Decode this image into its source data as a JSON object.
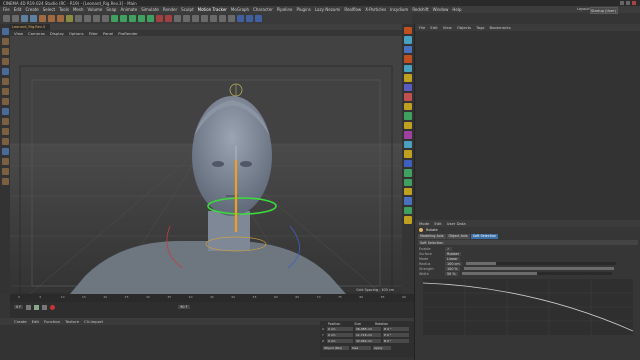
{
  "titlebar": {
    "title": "CINEMA 4D R19.024 Studio (RC - R19) - [Leonard_Rig.Rev.3] - Main"
  },
  "menu": {
    "items": [
      "File",
      "Edit",
      "Create",
      "Select",
      "Tools",
      "Mesh",
      "Volume",
      "Snap",
      "Animate",
      "Simulate",
      "Render",
      "Sculpt",
      "Motion Tracker",
      "MoGraph",
      "Character",
      "Pipeline",
      "Plugins",
      "Lazy Nezumi",
      "Realflow",
      "X-Particles",
      "Insydium",
      "Redshift",
      "Window",
      "Help"
    ],
    "highlight": "Motion Tracker",
    "layout_label": "Layout:",
    "layout_value": "Startup (User)"
  },
  "viewport": {
    "tab_label": "Leonard_Rig.Rev.3",
    "menu": [
      "View",
      "Cameras",
      "Display",
      "Options",
      "Filter",
      "Panel",
      "ProRender"
    ],
    "camera_label": "Perspective",
    "grid_spacing": "Grid Spacing : 100 cm"
  },
  "object_manager": {
    "menu": [
      "File",
      "Edit",
      "View",
      "Objects",
      "Tags",
      "Bookmarks"
    ]
  },
  "attributes": {
    "menu": [
      "Mode",
      "Edit",
      "User Data"
    ],
    "object_name": "Rotate",
    "tabs": [
      "Modeling Axis",
      "Object Axis",
      "Soft Selection"
    ],
    "active_tab": "Soft Selection",
    "section": "Soft Selection",
    "rows": [
      {
        "label": "Enable",
        "value": "✓"
      },
      {
        "label": "Surface",
        "value": "Rubber"
      },
      {
        "label": "Mode",
        "value": "Linear"
      },
      {
        "label": "Radius",
        "value": "100 cm"
      },
      {
        "label": "Strength",
        "value": "100 %"
      },
      {
        "label": "Width",
        "value": "50 %"
      }
    ],
    "slider_levels": [
      0.2,
      1.0,
      0.5
    ]
  },
  "timeline": {
    "ticks": [
      "0",
      "5",
      "10",
      "15",
      "20",
      "25",
      "30",
      "35",
      "40",
      "45",
      "50",
      "55",
      "60",
      "65",
      "70",
      "75",
      "80",
      "85",
      "90"
    ],
    "current_frame": "0 F",
    "end_frame": "90 F"
  },
  "material_manager": {
    "menu": [
      "Create",
      "Edit",
      "Function",
      "Texture",
      "CV-Import"
    ]
  },
  "coordinates": {
    "headers": [
      "Position",
      "Size",
      "Rotation"
    ],
    "rows": [
      {
        "axis": "X",
        "pos": "0 cm",
        "size": "36.085 cm",
        "rot": "H 0 °"
      },
      {
        "axis": "Y",
        "pos": "0 cm",
        "size": "11.716 cm",
        "rot": "P 0 °"
      },
      {
        "axis": "Z",
        "pos": "0 cm",
        "size": "32.064 cm",
        "rot": "B 0 °"
      }
    ],
    "mode_select": "Object (Rel)",
    "size_select": "Size",
    "apply_label": "Apply"
  }
}
